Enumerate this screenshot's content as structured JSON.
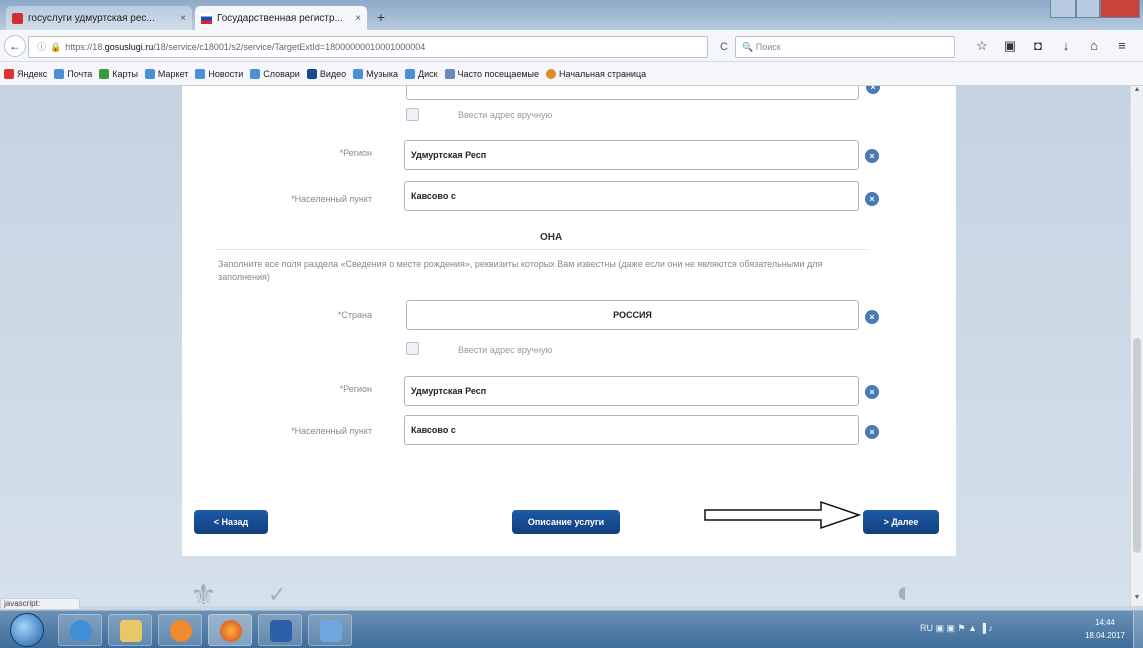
{
  "browser": {
    "tabs": [
      {
        "label": "госуслуги удмуртская рес...",
        "close": "×",
        "active": false
      },
      {
        "label": "Государственная регистр...",
        "close": "×",
        "active": true
      }
    ],
    "new_tab": "+",
    "address": {
      "info_icon": "ⓘ",
      "lock_icon": "🔒",
      "prefix": "https://18.",
      "domain": "gosuslugi.ru",
      "rest": "/18/service/c18001/s2/service/TargetExtId=18000000010001000004"
    },
    "reload": "C",
    "search_placeholder": "Поиск",
    "bookmarks": [
      "Яндекс",
      "Почта",
      "Карты",
      "Маркет",
      "Новости",
      "Словари",
      "Видео",
      "Музыка",
      "Диск",
      "Часто посещаемые",
      "Начальная страница"
    ]
  },
  "form": {
    "upper": {
      "manual_address_label": "Ввести адрес вручную",
      "region_label": "*Регион",
      "region_value": "Удмуртская Респ",
      "locality_label": "*Населенный пункт",
      "locality_value": "Кавсово с"
    },
    "section_title": "ОНА",
    "hint": "Заполните все поля раздела «Сведения о месте рождения», реквизиты которых Вам известны (даже если они не являются обязательными для заполнения)",
    "lower": {
      "country_label": "*Страна",
      "country_value": "РОССИЯ",
      "manual_address_label": "Ввести адрес вручную",
      "region_label": "*Регион",
      "region_value": "Удмуртская Респ",
      "locality_label": "*Населенный пункт",
      "locality_value": "Кавсово с"
    },
    "buttons": {
      "back": "< Назад",
      "description": "Описание услуги",
      "next": "> Далее"
    }
  },
  "statusbar": {
    "text": "javascript:"
  },
  "taskbar": {
    "tray_lang": "RU",
    "time": "14:44",
    "date": "18.04.2017"
  },
  "colors": {
    "button_blue": "#1d5aa6",
    "clear_blue": "#4a7ab5",
    "panel_bg": "#ffffff",
    "page_bg": "#c9d6e3"
  }
}
